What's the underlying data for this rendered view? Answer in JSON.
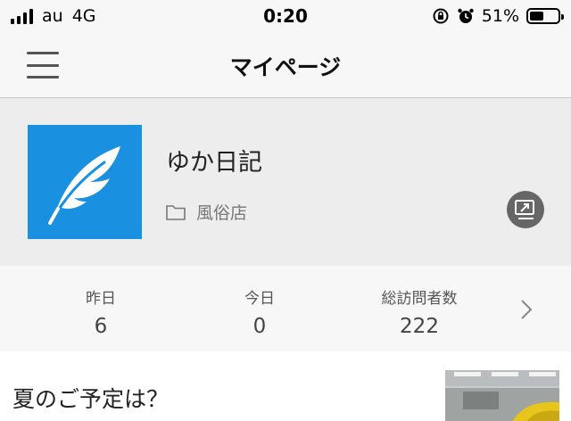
{
  "status_bar": {
    "carrier": "au",
    "network": "4G",
    "time": "0:20",
    "battery_percent": "51%",
    "battery_level": 0.51
  },
  "nav": {
    "title": "マイページ",
    "menu_icon": "hamburger-menu-icon"
  },
  "profile": {
    "blog_title": "ゆか日記",
    "category": "風俗店",
    "avatar_icon": "feather-icon",
    "avatar_color": "#1a90e0",
    "share_icon": "share-icon"
  },
  "stats": {
    "items": [
      {
        "label": "昨日",
        "value": "6"
      },
      {
        "label": "今日",
        "value": "0"
      },
      {
        "label": "総訪問者数",
        "value": "222"
      }
    ],
    "chevron_icon": "chevron-right-icon"
  },
  "article": {
    "title": "夏のご予定は？"
  }
}
